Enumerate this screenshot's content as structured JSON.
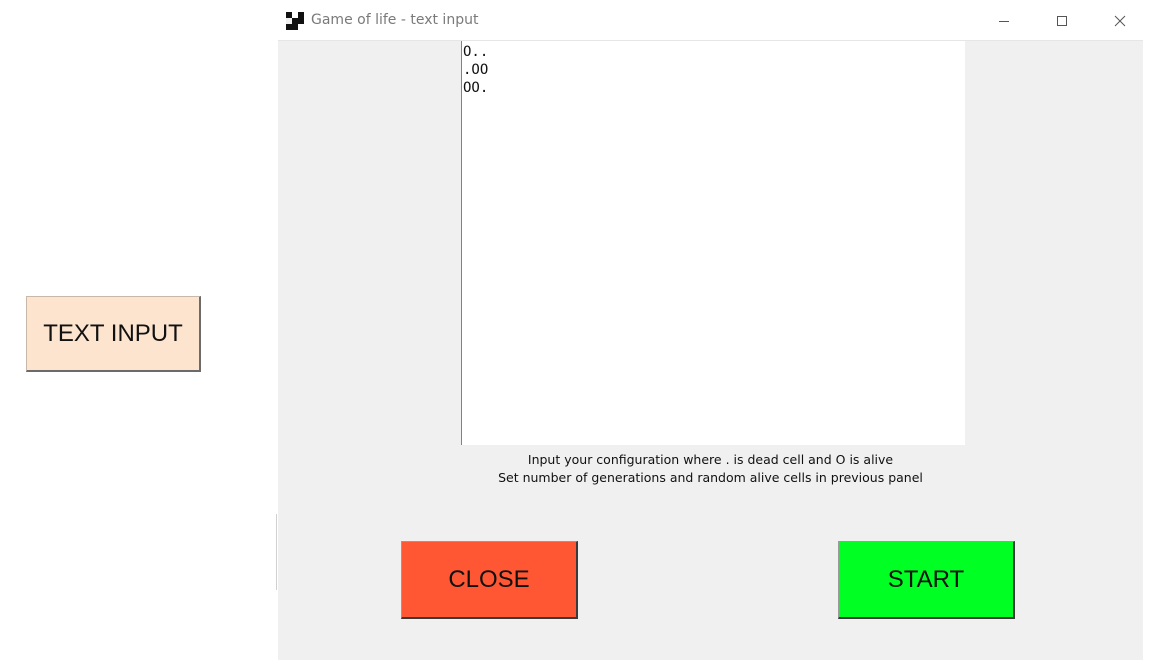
{
  "background": {
    "text_input_button_label": "TEXT INPUT",
    "button_color": "#fde4cf"
  },
  "window": {
    "title": "Game of life - text input",
    "app_icon": "checkerboard-icon",
    "controls": {
      "minimize": "minimize-icon",
      "maximize": "maximize-icon",
      "close": "close-icon"
    }
  },
  "config_input": {
    "value": "O..\n.OO\nOO."
  },
  "instructions": {
    "line1": "Input your configuration where . is dead cell and O is alive",
    "line2": "Set number of generations and random alive cells in previous panel"
  },
  "buttons": {
    "close_label": "CLOSE",
    "close_color": "#ff5733",
    "start_label": "START",
    "start_color": "#00ff22"
  }
}
